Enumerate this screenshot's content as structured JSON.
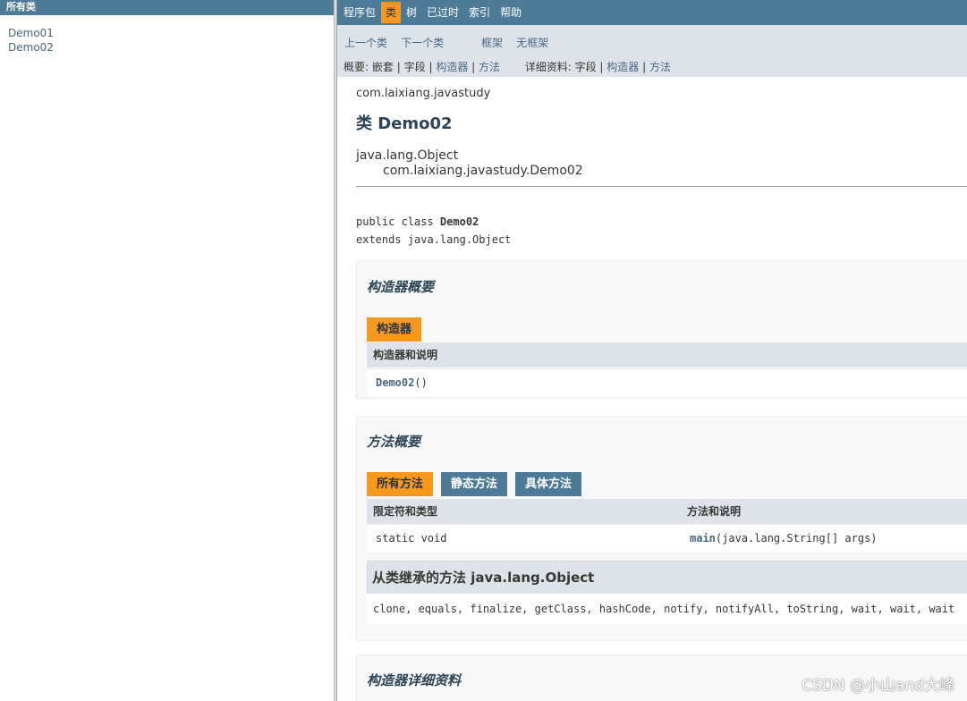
{
  "left_frame": {
    "header": "所有类",
    "classes": [
      "Demo01",
      "Demo02"
    ]
  },
  "top_nav": [
    "程序包",
    "类",
    "树",
    "已过时",
    "索引",
    "帮助"
  ],
  "top_nav_active": "类",
  "sub_nav": {
    "prev_class": "上一个类",
    "next_class": "下一个类",
    "frames": "框架",
    "no_frames": "无框架",
    "summary_label": "概要:",
    "summary_nested": "嵌套",
    "summary_field": "字段",
    "summary_constructor": "构造器",
    "summary_method": "方法",
    "detail_label": "详细资料:",
    "detail_field": "字段",
    "detail_constructor": "构造器",
    "detail_method": "方法"
  },
  "package_name": "com.laixiang.javastudy",
  "class_title": "类 Demo02",
  "inheritance": [
    "java.lang.Object",
    "com.laixiang.javastudy.Demo02"
  ],
  "declaration": {
    "line1_prefix": "public class ",
    "line1_name": "Demo02",
    "line2": "extends java.lang.Object"
  },
  "constructor_summary": {
    "heading": "构造器概要",
    "tab": "构造器",
    "column": "构造器和说明",
    "row_name": "Demo02",
    "row_suffix": "()"
  },
  "method_summary": {
    "heading": "方法概要",
    "tabs": [
      "所有方法",
      "静态方法",
      "具体方法"
    ],
    "columns": [
      "限定符和类型",
      "方法和说明"
    ],
    "rows": [
      {
        "modifier": "static void",
        "method_name": "main",
        "method_params": "(java.lang.String[]  args)"
      }
    ],
    "inherited_heading": "从类继承的方法 java.lang.Object",
    "inherited_methods": "clone, equals, finalize, getClass, hashCode, notify, notifyAll, toString, wait, wait, wait"
  },
  "constructor_detail": {
    "heading": "构造器详细资料"
  },
  "watermark": "CSDN @小山and大峰",
  "colors": {
    "nav_blue": "#4d7a97",
    "accent_orange": "#f8981d",
    "subnav_gray": "#dee3e9",
    "link": "#4a6782"
  }
}
